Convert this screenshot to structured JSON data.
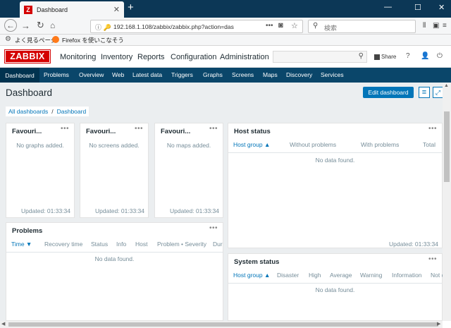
{
  "browser": {
    "tab_title": "Dashboard",
    "url": "192.168.1.108/zabbix/zabbix.php?action=das",
    "search_placeholder": "検索",
    "bookmarks": [
      "よく見るページ",
      "Firefox を使いこなそう"
    ]
  },
  "zabbix": {
    "logo": "ZABBIX",
    "menu": [
      "Monitoring",
      "Inventory",
      "Reports",
      "Configuration",
      "Administration"
    ],
    "share_label": "Share",
    "submenu": [
      "Dashboard",
      "Problems",
      "Overview",
      "Web",
      "Latest data",
      "Triggers",
      "Graphs",
      "Screens",
      "Maps",
      "Discovery",
      "Services"
    ]
  },
  "page": {
    "title": "Dashboard",
    "edit_button": "Edit dashboard",
    "breadcrumb": [
      "All dashboards",
      "Dashboard"
    ]
  },
  "widgets": {
    "fav_graphs": {
      "title": "Favouri...",
      "message": "No graphs added.",
      "updated": "Updated: 01:33:34"
    },
    "fav_screens": {
      "title": "Favouri...",
      "message": "No screens added.",
      "updated": "Updated: 01:33:34"
    },
    "fav_maps": {
      "title": "Favouri...",
      "message": "No maps added.",
      "updated": "Updated: 01:33:34"
    },
    "host_status": {
      "title": "Host status",
      "columns": [
        "Host group ▲",
        "Without problems",
        "With problems",
        "Total"
      ],
      "message": "No data found.",
      "updated": "Updated: 01:33:34"
    },
    "problems": {
      "title": "Problems",
      "columns": [
        "Time ▼",
        "Recovery time",
        "Status",
        "Info",
        "Host",
        "Problem • Severity",
        "Dur"
      ],
      "message": "No data found."
    },
    "system_status": {
      "title": "System status",
      "columns": [
        "Host group ▲",
        "Disaster",
        "High",
        "Average",
        "Warning",
        "Information",
        "Not c"
      ],
      "message": "No data found."
    },
    "dots": "•••"
  }
}
